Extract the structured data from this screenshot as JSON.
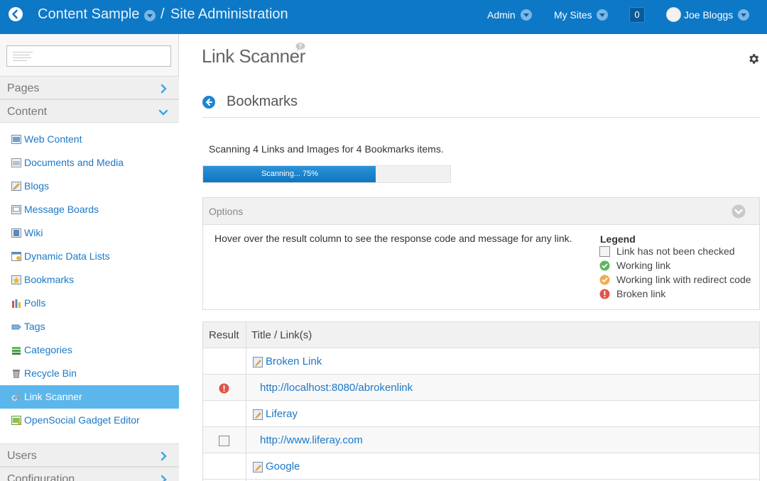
{
  "topbar": {
    "site": "Content Sample",
    "separator": "/",
    "section": "Site Administration",
    "admin": "Admin",
    "my_sites": "My Sites",
    "notifications": "0",
    "user": "Joe Bloggs",
    "bg_color": "#0d78c6"
  },
  "sidebar": {
    "pages_label": "Pages",
    "content_label": "Content",
    "items": [
      {
        "label": "Web Content",
        "icon": "web-content-icon"
      },
      {
        "label": "Documents and Media",
        "icon": "documents-icon"
      },
      {
        "label": "Blogs",
        "icon": "blogs-icon"
      },
      {
        "label": "Message Boards",
        "icon": "message-boards-icon"
      },
      {
        "label": "Wiki",
        "icon": "wiki-icon"
      },
      {
        "label": "Dynamic Data Lists",
        "icon": "ddl-icon"
      },
      {
        "label": "Bookmarks",
        "icon": "bookmarks-icon"
      },
      {
        "label": "Polls",
        "icon": "polls-icon"
      },
      {
        "label": "Tags",
        "icon": "tags-icon"
      },
      {
        "label": "Categories",
        "icon": "categories-icon"
      },
      {
        "label": "Recycle Bin",
        "icon": "recycle-bin-icon"
      },
      {
        "label": "Link Scanner",
        "icon": "link-scanner-icon",
        "active": true
      },
      {
        "label": "OpenSocial Gadget Editor",
        "icon": "gadget-editor-icon"
      }
    ],
    "users_label": "Users",
    "configuration_label": "Configuration",
    "active_color": "#5bb6eb"
  },
  "main": {
    "title": "Link Scanner",
    "subtitle": "Bookmarks",
    "scan_status": "Scanning 4 Links and Images for 4 Bookmarks items.",
    "progress": {
      "label": "Scanning... 75%",
      "percent": 75
    },
    "options": {
      "label": "Options",
      "hint": "Hover over the result column to see the response code and message for any link.",
      "legend_title": "Legend",
      "legend": [
        {
          "text": "Link has not been checked",
          "icon": "unchecked-icon"
        },
        {
          "text": "Working link",
          "icon": "working-link-icon",
          "color": "#5cb85c"
        },
        {
          "text": "Working link with redirect code",
          "icon": "redirect-link-icon",
          "color": "#f0ad4e"
        },
        {
          "text": "Broken link",
          "icon": "broken-link-icon",
          "color": "#e05547"
        }
      ]
    },
    "table": {
      "col_result": "Result",
      "col_title": "Title / Link(s)",
      "rows": [
        {
          "type": "title",
          "text": "Broken Link"
        },
        {
          "type": "link",
          "text": "http://localhost:8080/abrokenlink",
          "result": "broken"
        },
        {
          "type": "title",
          "text": "Liferay"
        },
        {
          "type": "link",
          "text": "http://www.liferay.com",
          "result": "unchecked"
        },
        {
          "type": "title",
          "text": "Google"
        }
      ]
    }
  }
}
